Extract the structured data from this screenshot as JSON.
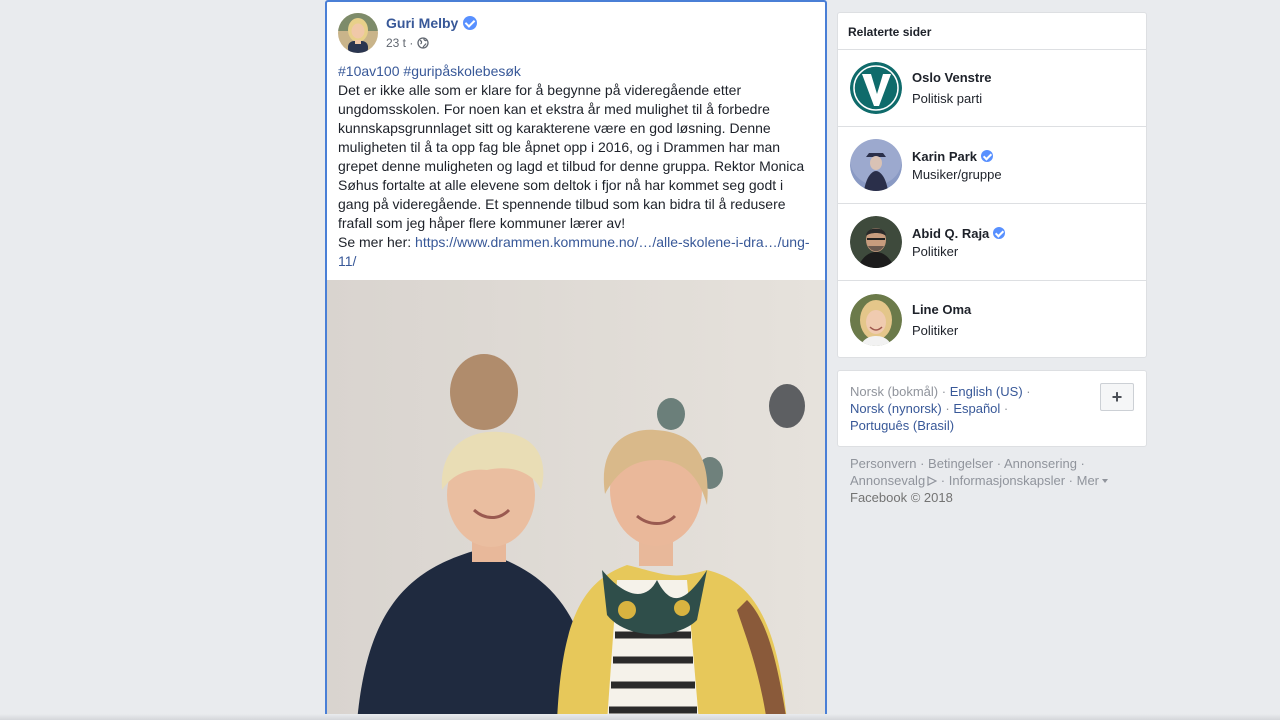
{
  "post": {
    "author": "Guri Melby",
    "time": "23 t ·",
    "hashtags": [
      "#10av100",
      "#guripåskolebesøk"
    ],
    "body": "Det er ikke alle som er klare for å begynne på videregående etter ungdomsskolen. For noen kan et ekstra år med mulighet til å forbedre kunnskapsgrunnlaget sitt og karakterene være en god løsning. Denne muligheten til å ta opp fag ble åpnet opp i 2016, og i Drammen har man grepet denne muligheten og lagd et tilbud for denne gruppa. Rektor Monica Søhus fortalte at alle elevene som deltok i fjor nå har kommet seg godt i gang på videregående. Et spennende tilbud som kan bidra til å redusere frafall som jeg håper flere kommuner lærer av!",
    "see_more_label": "Se mer her:",
    "link": "https://www.drammen.kommune.no/…/alle-skolene-i-dra…/ung-11/"
  },
  "related": {
    "title": "Relaterte sider",
    "items": [
      {
        "name": "Oslo Venstre",
        "sub": "Politisk parti",
        "verified": false
      },
      {
        "name": "Karin Park",
        "sub": "Musiker/gruppe",
        "verified": true
      },
      {
        "name": "Abid Q. Raja",
        "sub": "Politiker",
        "verified": true
      },
      {
        "name": "Line Oma",
        "sub": "Politiker",
        "verified": false
      }
    ]
  },
  "languages": {
    "current": "Norsk (bokmål)",
    "others": [
      "English (US)",
      "Norsk (nynorsk)",
      "Español",
      "Português (Brasil)"
    ],
    "add_label": "+"
  },
  "footer": {
    "links": [
      "Personvern",
      "Betingelser",
      "Annonsering",
      "Annonsevalg",
      "Informasjonskapsler",
      "Mer"
    ],
    "copyright": "Facebook © 2018"
  },
  "colors": {
    "link": "#385898",
    "verified": "#5890ff",
    "focus_border": "#4a7fd6",
    "background": "#e9ebee"
  }
}
